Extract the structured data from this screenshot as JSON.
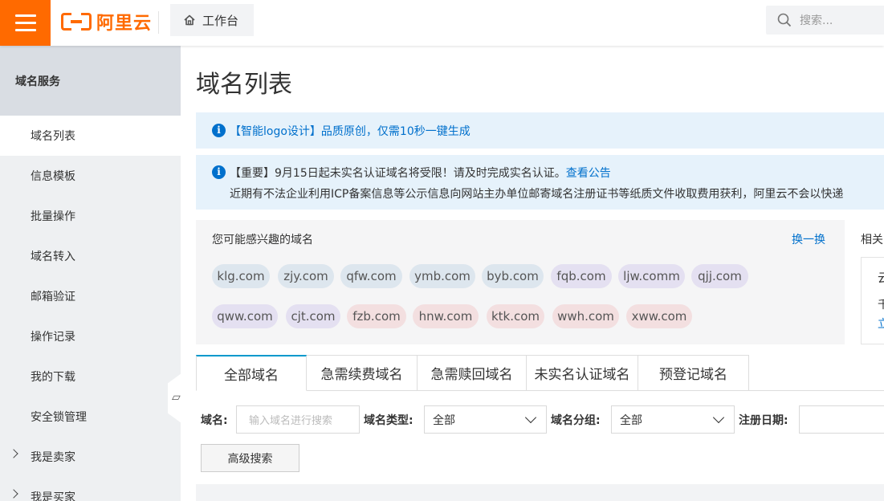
{
  "header": {
    "logo_text": "阿里云",
    "workbench_label": "工作台",
    "search_placeholder": "搜索..."
  },
  "sidebar": {
    "title": "域名服务",
    "items": [
      {
        "label": "域名列表",
        "active": true
      },
      {
        "label": "信息模板"
      },
      {
        "label": "批量操作"
      },
      {
        "label": "域名转入"
      },
      {
        "label": "邮箱验证"
      },
      {
        "label": "操作记录"
      },
      {
        "label": "我的下载"
      },
      {
        "label": "安全锁管理"
      },
      {
        "label": "我是卖家",
        "expandable": true
      },
      {
        "label": "我是买家",
        "expandable": true
      }
    ]
  },
  "main": {
    "title": "域名列表",
    "notice1": "【智能logo设计】品质原创，仅需10秒一键生成",
    "notice2": {
      "line1": "【重要】9月15日起未实名认证域名将受限！请及时完成实名认证。",
      "link": "查看公告",
      "line2": "近期有不法企业利用ICP备案信息等公示信息向网站主办单位邮寄域名注册证书等纸质文件收取费用获利，阿里云不会以快递"
    },
    "suggest": {
      "title": "您可能感兴趣的域名",
      "refresh": "换一换",
      "domains": [
        "klg.com",
        "zjy.com",
        "qfw.com",
        "ymb.com",
        "byb.com",
        "fqb.com",
        "ljw.comm",
        "qjj.com",
        "qww.com",
        "cjt.com",
        "fzb.com",
        "hnw.com",
        "ktk.com",
        "wwh.com",
        "xww.com"
      ]
    },
    "related": {
      "title": "相关",
      "card_line1": "云",
      "card_line2": "千",
      "card_link": "立"
    },
    "tabs": [
      "全部域名",
      "急需续费域名",
      "急需赎回域名",
      "未实名认证域名",
      "预登记域名"
    ],
    "filters": {
      "domain_label": "域名:",
      "domain_placeholder": "输入域名进行搜索",
      "type_label": "域名类型:",
      "type_value": "全部",
      "group_label": "域名分组:",
      "group_value": "全部",
      "date_label": "注册日期:",
      "advanced_button": "高级搜索"
    }
  },
  "colors": {
    "brand": "#ff6a00",
    "link": "#0070cc",
    "notice_bg": "#e6f2fb",
    "tab_accent": "#0099cc"
  }
}
